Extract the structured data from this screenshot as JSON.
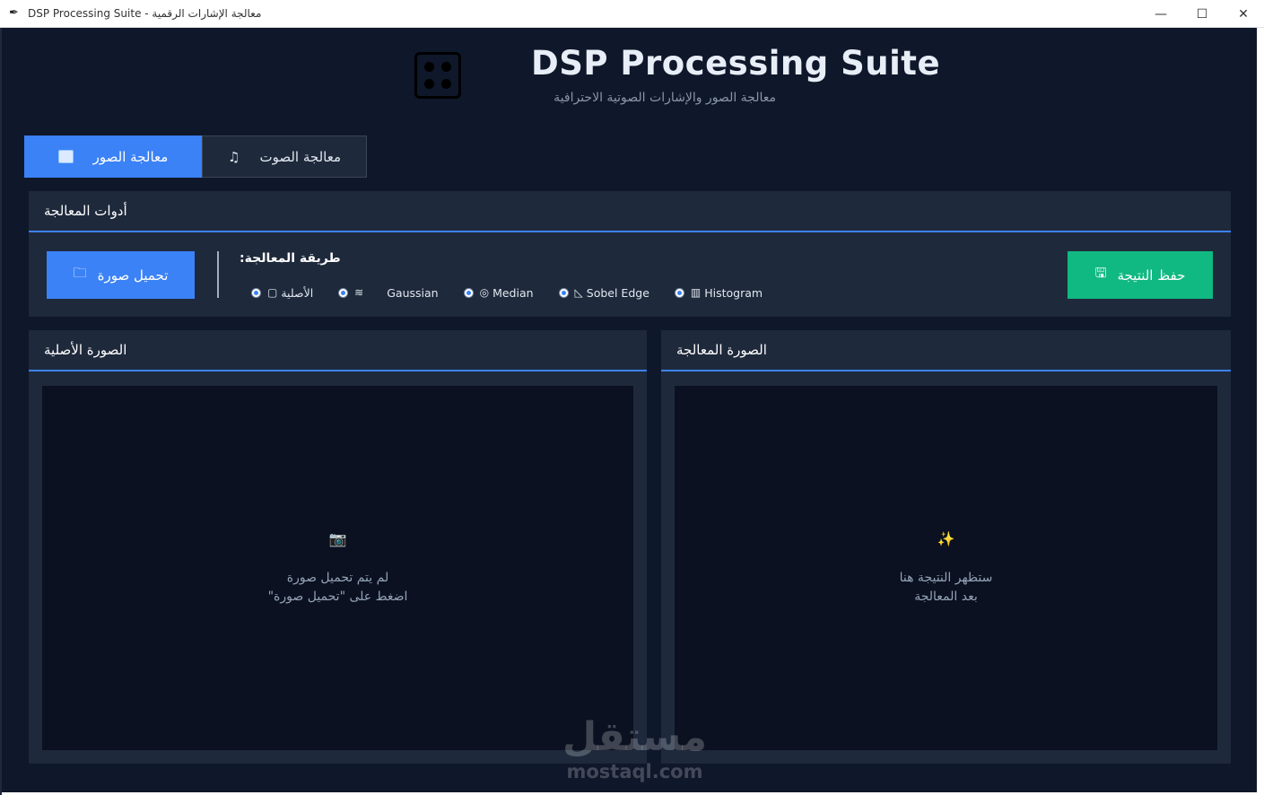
{
  "window": {
    "title": "DSP Processing Suite - معالجة الإشارات الرقمية",
    "controls": {
      "minimize": "—",
      "maximize": "☐",
      "close": "✕"
    }
  },
  "header": {
    "title": "DSP Processing Suite",
    "subtitle": "معالجة الصور والإشارات الصوتية الاحترافية",
    "logo_icon": "dice-icon"
  },
  "tabs": [
    {
      "label": "معالجة الصور",
      "icon": "image-icon",
      "active": true
    },
    {
      "label": "معالجة الصوت",
      "icon": "music-icon",
      "active": false
    }
  ],
  "tools": {
    "header": "أدوات المعالجة",
    "load_button": "تحميل صورة",
    "method_label": ":طريقة المعالجة",
    "save_button": "حفظ النتيجة",
    "methods": [
      {
        "label": "الأصلية",
        "icon": "▢",
        "selected": true
      },
      {
        "label": "Gaussian",
        "icon": "≋",
        "selected": true
      },
      {
        "label": "Median",
        "icon": "◎",
        "selected": true
      },
      {
        "label": "Sobel Edge",
        "icon": "◺",
        "selected": true
      },
      {
        "label": "Histogram",
        "icon": "▥",
        "selected": true
      }
    ]
  },
  "panels": {
    "original": {
      "title": "الصورة الأصلية",
      "icon": "📷",
      "line1": "لم يتم تحميل صورة",
      "line2": "اضغط على \"تحميل صورة\""
    },
    "processed": {
      "title": "الصورة المعالجة",
      "icon": "✨",
      "line1": "ستظهر النتيجة هنا",
      "line2": "بعد المعالجة"
    }
  },
  "watermark": {
    "arabic": "مستقل",
    "latin": "mostaql.com"
  },
  "colors": {
    "accent": "#3b82f6",
    "save": "#10b981",
    "background": "#0f172a",
    "panel": "#1e293b"
  }
}
